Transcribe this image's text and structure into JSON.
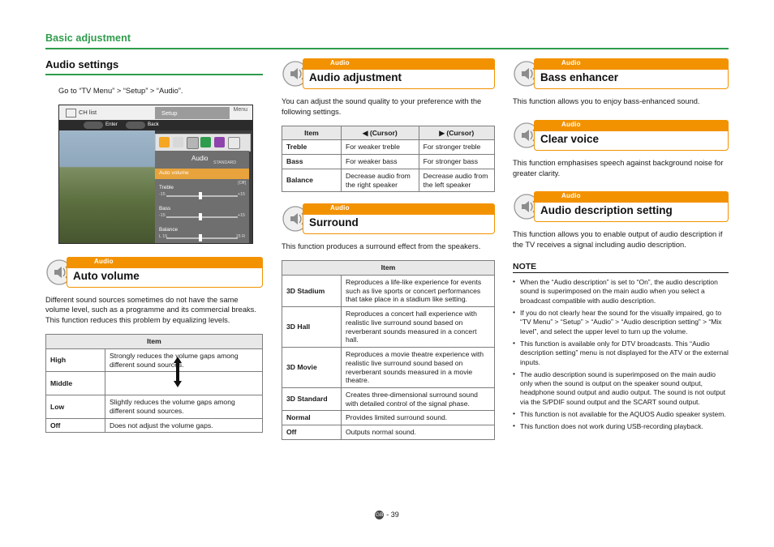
{
  "header": {
    "title": "Basic adjustment"
  },
  "footer": {
    "badge": "GB",
    "page": "- 39"
  },
  "col1": {
    "section_title": "Audio settings",
    "intro": "Go to “TV Menu” > “Setup” > “Audio”.",
    "tv": {
      "menu": "Menu",
      "ch_list": "CH list",
      "setup": "Setup",
      "enter": "Enter",
      "back": "Back",
      "audio": "Audio",
      "auto_volume": "Auto volume",
      "standard": "STANDARD",
      "off": "[Off]",
      "treble": "Treble",
      "bass": "Bass",
      "balance": "Balance",
      "minus": "-15",
      "plus": "+15",
      "bal_l": "L 15",
      "bal_r": "15 R"
    },
    "banner": {
      "category": "Audio",
      "title": "Auto volume"
    },
    "body": "Different sound sources sometimes do not have the same volume level, such as a programme and its commercial breaks. This function reduces this problem by equalizing levels.",
    "table": {
      "header": "Item",
      "rows": [
        {
          "k": "High",
          "v": "Strongly reduces the volume gaps among different sound sources."
        },
        {
          "k": "Middle",
          "v": ""
        },
        {
          "k": "Low",
          "v": "Slightly reduces the volume gaps among different sound sources."
        },
        {
          "k": "Off",
          "v": "Does not adjust the volume gaps."
        }
      ]
    }
  },
  "col2": {
    "audio_adjustment": {
      "banner": {
        "category": "Audio",
        "title": "Audio adjustment"
      },
      "body": "You can adjust the sound quality to your preference with the following settings.",
      "table": {
        "headers": [
          "Item",
          "◀ (Cursor)",
          "▶ (Cursor)"
        ],
        "rows": [
          {
            "k": "Treble",
            "left": "For weaker treble",
            "right": "For stronger treble"
          },
          {
            "k": "Bass",
            "left": "For weaker bass",
            "right": "For stronger bass"
          },
          {
            "k": "Balance",
            "left": "Decrease audio from the right speaker",
            "right": "Decrease audio from the left speaker"
          }
        ]
      }
    },
    "surround": {
      "banner": {
        "category": "Audio",
        "title": "Surround"
      },
      "body": "This function produces a surround effect from the speakers.",
      "table": {
        "header": "Item",
        "rows": [
          {
            "k": "3D Stadium",
            "v": "Reproduces a life-like experience for events such as live sports or concert performances that take place in a stadium like setting."
          },
          {
            "k": "3D Hall",
            "v": "Reproduces a concert hall experience with realistic live surround sound based on reverberant sounds measured in a concert hall."
          },
          {
            "k": "3D Movie",
            "v": "Reproduces a movie theatre experience with realistic live surround sound based on reverberant sounds measured in a movie theatre."
          },
          {
            "k": "3D Standard",
            "v": "Creates three-dimensional surround sound with detailed control of the signal phase."
          },
          {
            "k": "Normal",
            "v": "Provides limited surround sound."
          },
          {
            "k": "Off",
            "v": "Outputs normal sound."
          }
        ]
      }
    }
  },
  "col3": {
    "bass_enhancer": {
      "banner": {
        "category": "Audio",
        "title": "Bass enhancer"
      },
      "body": "This function allows you to enjoy bass-enhanced sound."
    },
    "clear_voice": {
      "banner": {
        "category": "Audio",
        "title": "Clear voice"
      },
      "body": "This function emphasises speech against background noise for greater clarity."
    },
    "audio_description": {
      "banner": {
        "category": "Audio",
        "title": "Audio description setting"
      },
      "body": "This function allows you to enable output of audio description if the TV receives a signal including audio description.",
      "note_title": "NOTE",
      "notes": [
        "When the “Audio description” is set to “On”, the audio description sound is superimposed on the main audio when you select a broadcast compatible with audio description.",
        "If you do not clearly hear the sound for the visually impaired, go to “TV Menu” > “Setup” > “Audio” > “Audio description setting” > “Mix level”, and select the upper level to turn up the volume.",
        "This function is available only for DTV broadcasts. This “Audio description setting” menu is not displayed for the ATV or the external inputs.",
        "The audio description sound is superimposed on the main audio only when the sound is output on the speaker sound output, headphone sound output and audio output. The sound is not output via the S/PDIF sound output and the SCART sound output.",
        "This function is not available for the AQUOS Audio speaker system.",
        "This function does not work during USB-recording playback."
      ]
    }
  }
}
